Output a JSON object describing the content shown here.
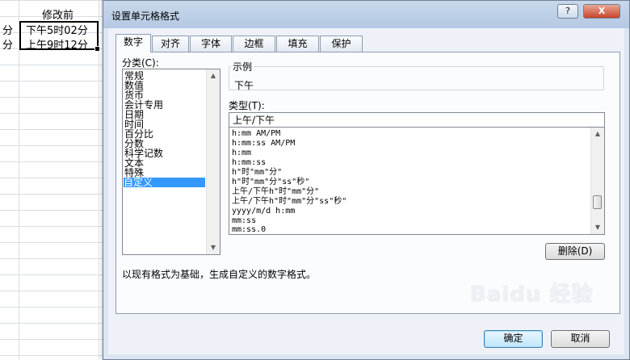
{
  "sheet": {
    "header_cell": "修改前",
    "rows": [
      {
        "left": "分",
        "value": "下午5时02分"
      },
      {
        "left": "分",
        "value": "上午9时12分"
      }
    ]
  },
  "dialog": {
    "title": "设置单元格格式",
    "help_label": "?",
    "close_label": "X",
    "tabs": [
      "数字",
      "对齐",
      "字体",
      "边框",
      "填充",
      "保护"
    ],
    "category_label": "分类(C):",
    "categories": [
      "常规",
      "数值",
      "货币",
      "会计专用",
      "日期",
      "时间",
      "百分比",
      "分数",
      "科学记数",
      "文本",
      "特殊",
      "自定义"
    ],
    "selected_category": "自定义",
    "sample_label": "示例",
    "sample_value": "下午",
    "type_label": "类型(T):",
    "type_value": "上午/下午",
    "formats": [
      "h:mm AM/PM",
      "h:mm:ss AM/PM",
      "h:mm",
      "h:mm:ss",
      "h\"时\"mm\"分\"",
      "h\"时\"mm\"分\"ss\"秒\"",
      "上午/下午h\"时\"mm\"分\"",
      "上午/下午h\"时\"mm\"分\"ss\"秒\"",
      "yyyy/m/d h:mm",
      "mm:ss",
      "mm:ss.0"
    ],
    "delete_label": "删除(D)",
    "description": "以现有格式为基础，生成自定义的数字格式。",
    "ok_label": "确定",
    "cancel_label": "取消"
  },
  "watermark": "Baidu 经验"
}
